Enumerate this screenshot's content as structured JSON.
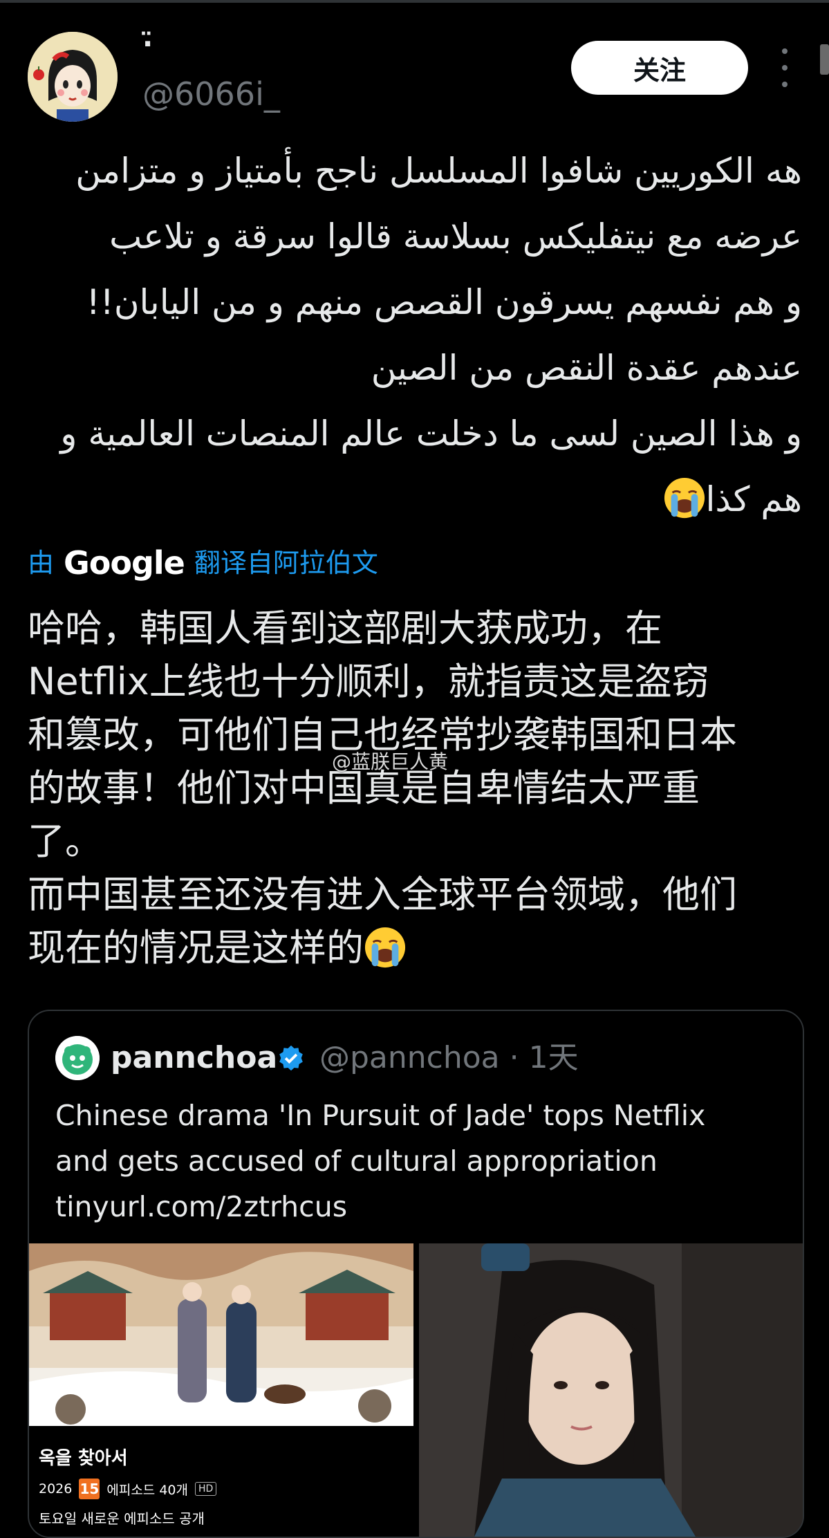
{
  "tweet": {
    "display_name": "·̈",
    "handle": "@6066i_",
    "follow_label": "关注",
    "arabic_lines": [
      "ﻫﻪ ﺍﻟﻜﻮﺭﻳﻴﻦ ﺷﺎﻓﻮﺍ ﺍﻟﻤﺴﻠﺴﻞ ﻧﺎﺟﺢ ﺑﺄﻣﺘﻴﺎﺯ ﻭ ﻣﺘﺰﺍﻣﻦ",
      "ﻋﺮﺿﻪ ﻣﻊ ﻧﻴﺘﻔﻠﻴﻜﺲ ﺑﺴﻼﺳﺔ ﻗﺎﻟﻮﺍ ﺳﺮﻗﺔ ﻭ ﺗﻼﻋﺐ",
      "ﻭ ﻫﻢ ﻧﻔﺴﻬﻢ ﻳﺴﺮﻗﻮﻥ ﺍﻟﻘﺼﺺ ﻣﻨﻬﻢ ﻭ ﻣﻦ ﺍﻟﻴﺎﺑﺎﻥ!!",
      "ﻋﻨﺪﻫﻢ ﻋﻘﺪﺓ ﺍﻟﻨﻘﺺ ﻣﻦ ﺍﻟﺼﻴﻦ",
      "ﻭ ﻫﺬﺍ ﺍﻟﺼﻴﻦ ﻟﺴﻰ ﻣﺎ ﺩﺧﻠﺖ ﻋﺎﻟﻢ ﺍﻟﻤﻨﺼﺎﺕ ﺍﻟﻌﺎﻟﻤﻴﺔ ﻭ",
      "ﻫﻢ ﻛﺬﺍ"
    ],
    "translate_by": "由",
    "translate_provider": "Google",
    "translate_link": "翻译自阿拉伯文",
    "chinese_lines": [
      "哈哈，韩国人看到这部剧大获成功，在",
      "Netflix上线也十分顺利，就指责这是盗窃",
      "和篡改，可他们自己也经常抄袭韩国和日本",
      "的故事！他们对中国真是自卑情结太严重",
      "了。",
      "而中国甚至还没有进入全球平台领域，他们",
      "现在的情况是这样的"
    ],
    "watermark": "@蓝朕巨人黄"
  },
  "quoted": {
    "name": "pannchoa",
    "handle_time": "@pannchoa · 1天",
    "text_lines": [
      "Chinese drama 'In Pursuit of Jade' tops Netflix",
      "and gets accused of cultural appropriation",
      "tinyurl.com/2ztrhcus"
    ],
    "media_title": "옥을 찾아서",
    "media_year": "2026",
    "media_age": "15",
    "media_episodes": "에피소드 40개",
    "media_hd": "HD",
    "media_sub": "토요일 새로운 에피소드 공개"
  },
  "colors": {
    "background": "#000000",
    "text": "#e7e9ea",
    "muted": "#71767b",
    "link": "#1d9bf0",
    "border": "#2f3336"
  }
}
